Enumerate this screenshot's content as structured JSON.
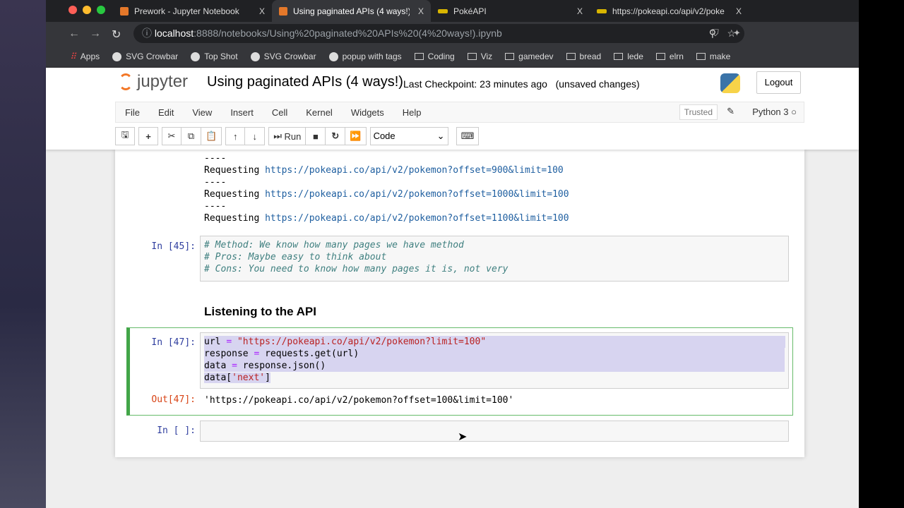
{
  "browser": {
    "tabs": [
      {
        "label": "Prework - Jupyter Notebook",
        "close": "X"
      },
      {
        "label": "Using paginated APIs (4 ways!)",
        "close": "X"
      },
      {
        "label": "PokéAPI",
        "close": "X"
      },
      {
        "label": "https://pokeapi.co/api/v2/poke",
        "close": "X"
      }
    ],
    "url_host": "localhost",
    "url_rest": ":8888/notebooks/Using%20paginated%20APIs%20(4%20ways!).ipynb",
    "bookmarks": [
      "Apps",
      "SVG Crowbar",
      "Top Shot",
      "SVG Crowbar",
      "popup with tags",
      "Coding",
      "Viz",
      "gamedev",
      "bread",
      "lede",
      "elrn",
      "make"
    ]
  },
  "header": {
    "logo": "jupyter",
    "title": "Using paginated APIs (4 ways!)",
    "checkpoint": "Last Checkpoint: 23 minutes ago",
    "unsaved": "(unsaved changes)",
    "logout": "Logout"
  },
  "menu": {
    "items": [
      "File",
      "Edit",
      "View",
      "Insert",
      "Cell",
      "Kernel",
      "Widgets",
      "Help"
    ],
    "trusted": "Trusted",
    "kernel": "Python 3"
  },
  "toolbar": {
    "run": "Run",
    "cell_type": "Code"
  },
  "cells": {
    "out_lines": [
      {
        "prefix": "Requesting ",
        "url": "https://pokeapi.co/api/v2/pokemon?offset=900&limit=100"
      },
      {
        "prefix": "Requesting ",
        "url": "https://pokeapi.co/api/v2/pokemon?offset=1000&limit=100"
      },
      {
        "prefix": "Requesting ",
        "url": "https://pokeapi.co/api/v2/pokemon?offset=1100&limit=100"
      }
    ],
    "sep": "----",
    "c45": {
      "prompt": "In [45]:",
      "lines": [
        "# Method: We know how many pages we have method",
        "# Pros: Maybe easy to think about",
        "# Cons: You need to know how many pages it is, not very"
      ]
    },
    "heading": "Listening to the API",
    "c47": {
      "prompt": "In [47]:",
      "out_prompt": "Out[47]:",
      "l1a": "url ",
      "l1op": "=",
      "l1s": " \"https://pokeapi.co/api/v2/pokemon?limit=100\"",
      "l2a": "response ",
      "l2op": "=",
      "l2b": " requests.get(url)",
      "l3a": "data ",
      "l3op": "=",
      "l3b": " response.json()",
      "l4a": "data[",
      "l4s": "'next'",
      "l4b": "]",
      "output": "'https://pokeapi.co/api/v2/pokemon?offset=100&limit=100'"
    },
    "empty": {
      "prompt": "In [ ]:"
    }
  }
}
